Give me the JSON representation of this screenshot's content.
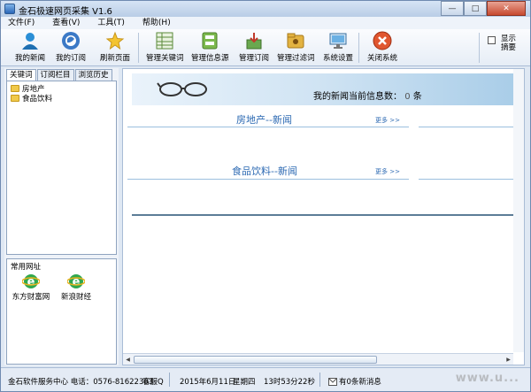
{
  "window": {
    "title": "金石极速网页采集 V1.6"
  },
  "menu": [
    "文件(F)",
    "查看(V)",
    "工具(T)",
    "帮助(H)"
  ],
  "toolbar": {
    "buttons": [
      {
        "label": "我的新闻",
        "icon": "user-icon"
      },
      {
        "label": "我的订阅",
        "icon": "subscribe-icon"
      },
      {
        "label": "刷新页面",
        "icon": "refresh-star-icon"
      },
      {
        "label": "管理关键词",
        "icon": "table-icon"
      },
      {
        "label": "管理信息源",
        "icon": "source-icon"
      },
      {
        "label": "管理订阅",
        "icon": "subscription-manage-icon"
      },
      {
        "label": "管理过滤词",
        "icon": "filter-icon"
      },
      {
        "label": "系统设置",
        "icon": "monitor-icon"
      },
      {
        "label": "关闭系统",
        "icon": "close-system-icon"
      }
    ],
    "show_toggle": "显示 摘要"
  },
  "left": {
    "tabs": [
      "关键词",
      "订阅栏目",
      "浏览历史"
    ],
    "tree": [
      "房地产",
      "食品饮料"
    ],
    "sites_title": "常用网址",
    "sites": [
      "东方财富网",
      "新浪财经"
    ]
  },
  "main": {
    "banner_text": "我的新闻当前信息数：",
    "banner_count": "0",
    "banner_unit": "条",
    "sections": [
      {
        "title": "房地产--新闻",
        "more": "更多 >>"
      },
      {
        "title": "食品饮料--新闻",
        "more": "更多 >>"
      }
    ]
  },
  "status": {
    "company": "金石软件服务中心 电话：0576-81622303",
    "service": "客服Q",
    "date": "2015年6月11日",
    "weekday": "星期四",
    "time": "13时53分22秒",
    "messages": "有0条新消息",
    "watermark": "www.u..."
  },
  "colors": {
    "accent": "#2d6ab3",
    "title_bg": "#c7d9ef"
  }
}
